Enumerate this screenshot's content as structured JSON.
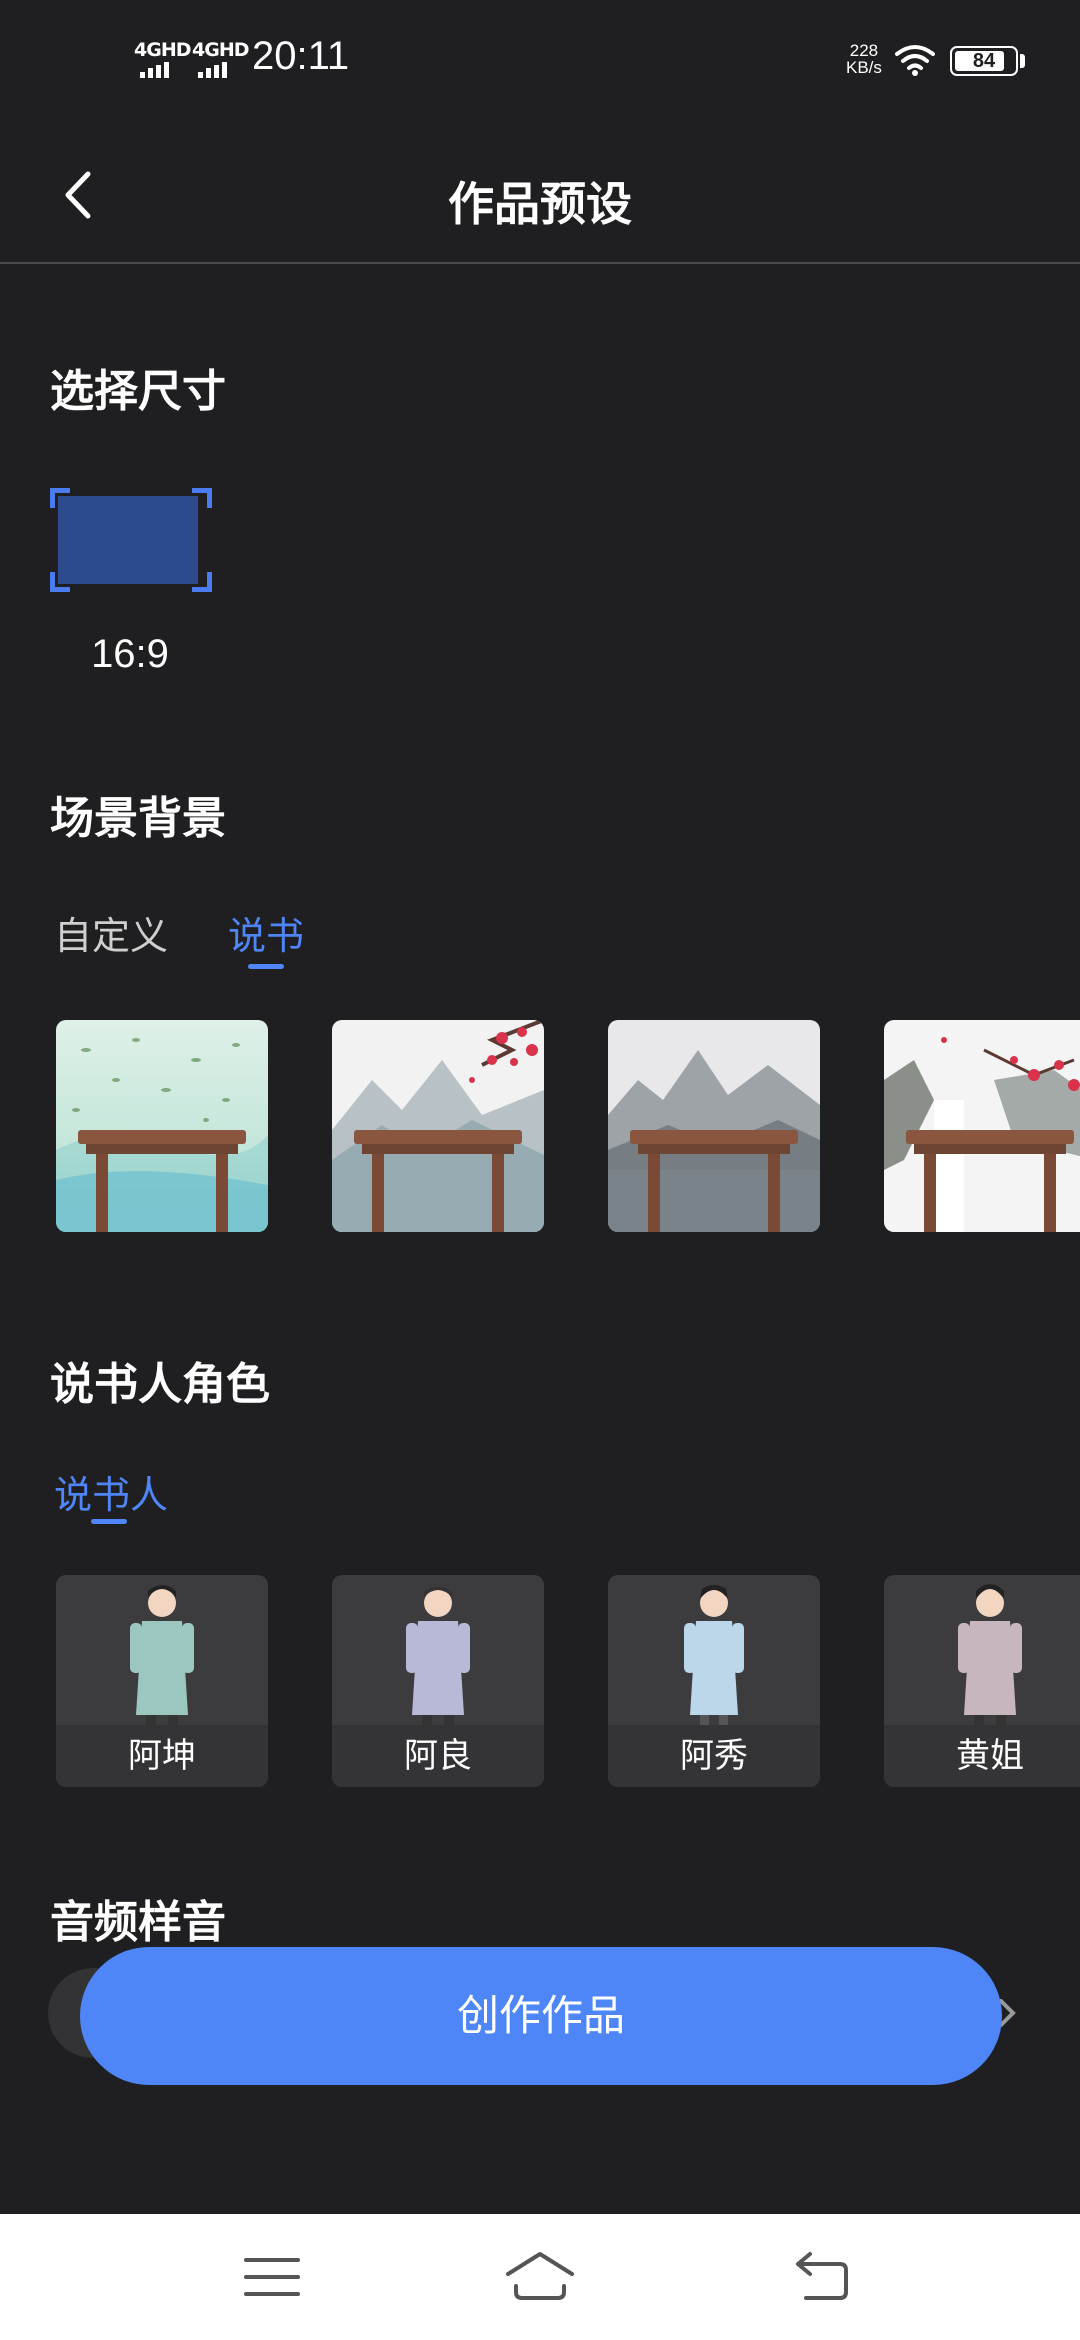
{
  "status_bar": {
    "sim1": "4GHD",
    "sim2": "4GHD",
    "time": "20:11",
    "net_speed_value": "228",
    "net_speed_unit": "KB/s",
    "battery": "84",
    "battery_level": 0.84,
    "icons": [
      "signal-icon",
      "signal-icon",
      "wifi-icon",
      "battery-icon"
    ]
  },
  "header": {
    "title": "作品预设",
    "back_icon": "chevron-left-icon"
  },
  "size_section": {
    "title": "选择尺寸",
    "options": [
      {
        "label": "16:9",
        "selected": true
      }
    ]
  },
  "scene_section": {
    "title": "场景背景",
    "tabs": [
      {
        "label": "自定义",
        "active": false
      },
      {
        "label": "说书",
        "active": true
      }
    ],
    "thumbnails": [
      "scene-bamboo-leaves",
      "scene-mountain-plum",
      "scene-misty-lake",
      "scene-plum-waterfall"
    ]
  },
  "narrator_section": {
    "title": "说书人角色",
    "tabs": [
      {
        "label": "说书人",
        "active": true
      }
    ],
    "characters": [
      {
        "name": "阿坤",
        "robe_color": "#9cc7c1"
      },
      {
        "name": "阿良",
        "robe_color": "#b8b9d6"
      },
      {
        "name": "阿秀",
        "robe_color": "#bcd6ea"
      },
      {
        "name": "黄姐",
        "robe_color": "#c7b6bd"
      }
    ]
  },
  "audio_section": {
    "title": "音频样音"
  },
  "create_button": {
    "label": "创作作品"
  },
  "bottom_nav": {
    "icons": [
      "menu-icon",
      "home-icon",
      "back-icon"
    ]
  },
  "colors": {
    "background": "#1f1f21",
    "accent": "#4f86f7",
    "selected_fill": "#2d4a8c"
  }
}
